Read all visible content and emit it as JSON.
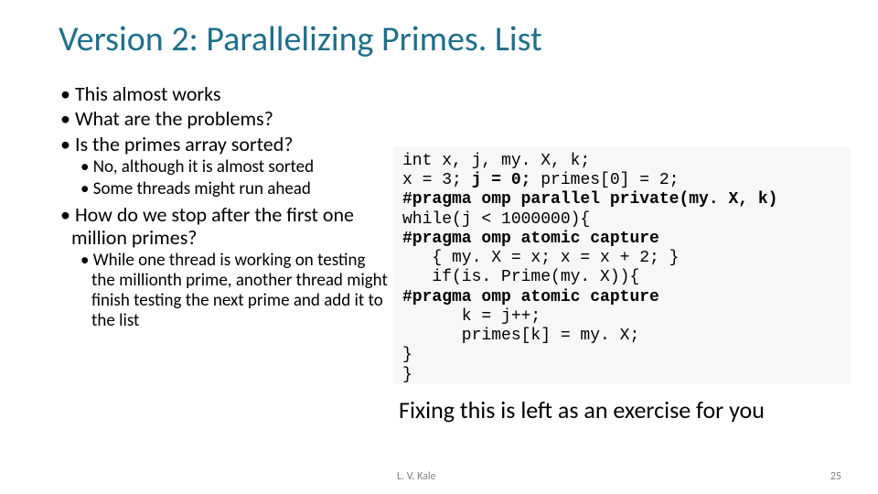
{
  "title": "Version 2: Parallelizing Primes. List",
  "bullets": {
    "b1": "This almost works",
    "b2": "What are the problems?",
    "b3": "Is the primes array sorted?",
    "b3a": "No, although it is almost sorted",
    "b3b": "Some threads might run ahead",
    "b4": "How do we stop after the first one million primes?",
    "b4a": "While one thread is working on testing the millionth prime, another thread might finish testing the next prime and add it to the list"
  },
  "code": {
    "l1": "int x, j, my. X, k;",
    "l2a": "x = 3; ",
    "l2b": "j = 0;",
    "l2c": " primes[0] = 2;",
    "l3": "#pragma omp parallel private(my. X, k)",
    "l4": "while(j < 1000000){",
    "l5": "#pragma omp atomic capture",
    "l6": "   { my. X = x; x = x + 2; }",
    "l7": "   if(is. Prime(my. X)){",
    "l8": "#pragma omp atomic capture",
    "l9": "      k = j++;",
    "l10": "      primes[k] = my. X;",
    "l11": "}",
    "l12": "}"
  },
  "exercise": "Fixing this is left as an exercise for you",
  "footer": {
    "author": "L. V. Kale",
    "num": "25"
  }
}
